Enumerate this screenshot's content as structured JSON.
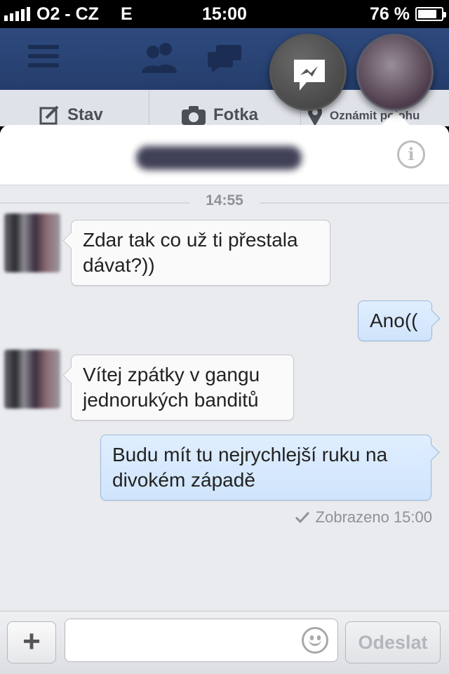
{
  "status_bar": {
    "carrier": "O2 - CZ",
    "network": "E",
    "time": "15:00",
    "battery_percent": "76 %",
    "battery_level": 0.76,
    "signal_bars": 5
  },
  "background_app": {
    "subbar": {
      "status_label": "Stav",
      "photo_label": "Fotka",
      "location_label": "Oznámit polohu"
    }
  },
  "chat": {
    "contact_name": "",
    "time_divider": "14:55",
    "messages": [
      {
        "direction": "incoming",
        "text": "Zdar tak co už ti přestala dávat?))"
      },
      {
        "direction": "outgoing",
        "text": "Ano(("
      },
      {
        "direction": "incoming",
        "text": "Vítej zpátky v gangu jednorukých banditů"
      },
      {
        "direction": "outgoing",
        "text": "Budu mít tu nejrychlejší ruku na divokém západě"
      }
    ],
    "seen_label": "Zobrazeno 15:00"
  },
  "composer": {
    "add_label": "+",
    "input_value": "",
    "input_placeholder": "",
    "send_label": "Odeslat"
  },
  "icons": {
    "info": "info-icon",
    "emoji": "smiley-icon",
    "seen": "checkmark-icon",
    "messenger": "messenger-bolt-icon"
  },
  "colors": {
    "fb_blue": "#2e4a7e",
    "outgoing_bubble": "#d6e8fd",
    "panel_bg": "#e9ebef"
  }
}
